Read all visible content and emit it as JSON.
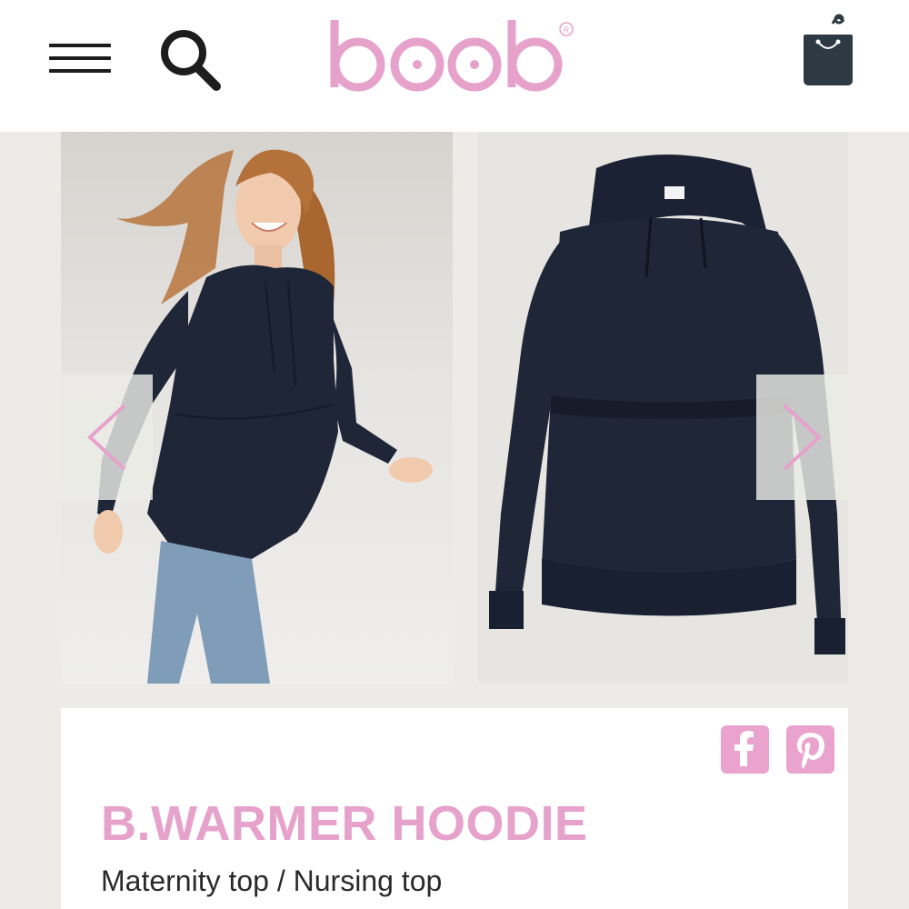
{
  "header": {
    "logo_text": "boob",
    "menu_icon": "hamburger-menu-icon",
    "search_icon": "search-icon",
    "cart_icon": "shopping-bag-icon"
  },
  "gallery": {
    "images": [
      {
        "name": "model-photo",
        "description_icon": "photo"
      },
      {
        "name": "product-photo",
        "description_icon": "photo"
      }
    ],
    "prev_icon": "chevron-left-icon",
    "next_icon": "chevron-right-icon"
  },
  "product": {
    "title": "B.WARMER HOODIE",
    "subtitle": "Maternity top / Nursing top"
  },
  "share": {
    "facebook_icon": "facebook-icon",
    "pinterest_icon": "pinterest-icon"
  },
  "colors": {
    "brand_pink": "#e6a2cb",
    "share_pink": "#eaa3cd",
    "header_bg": "#ffffff",
    "page_bg": "#ecebe7",
    "icon_dark": "#1d1d1d",
    "cart_dark": "#2d3a44",
    "navy": "#1e2638"
  }
}
